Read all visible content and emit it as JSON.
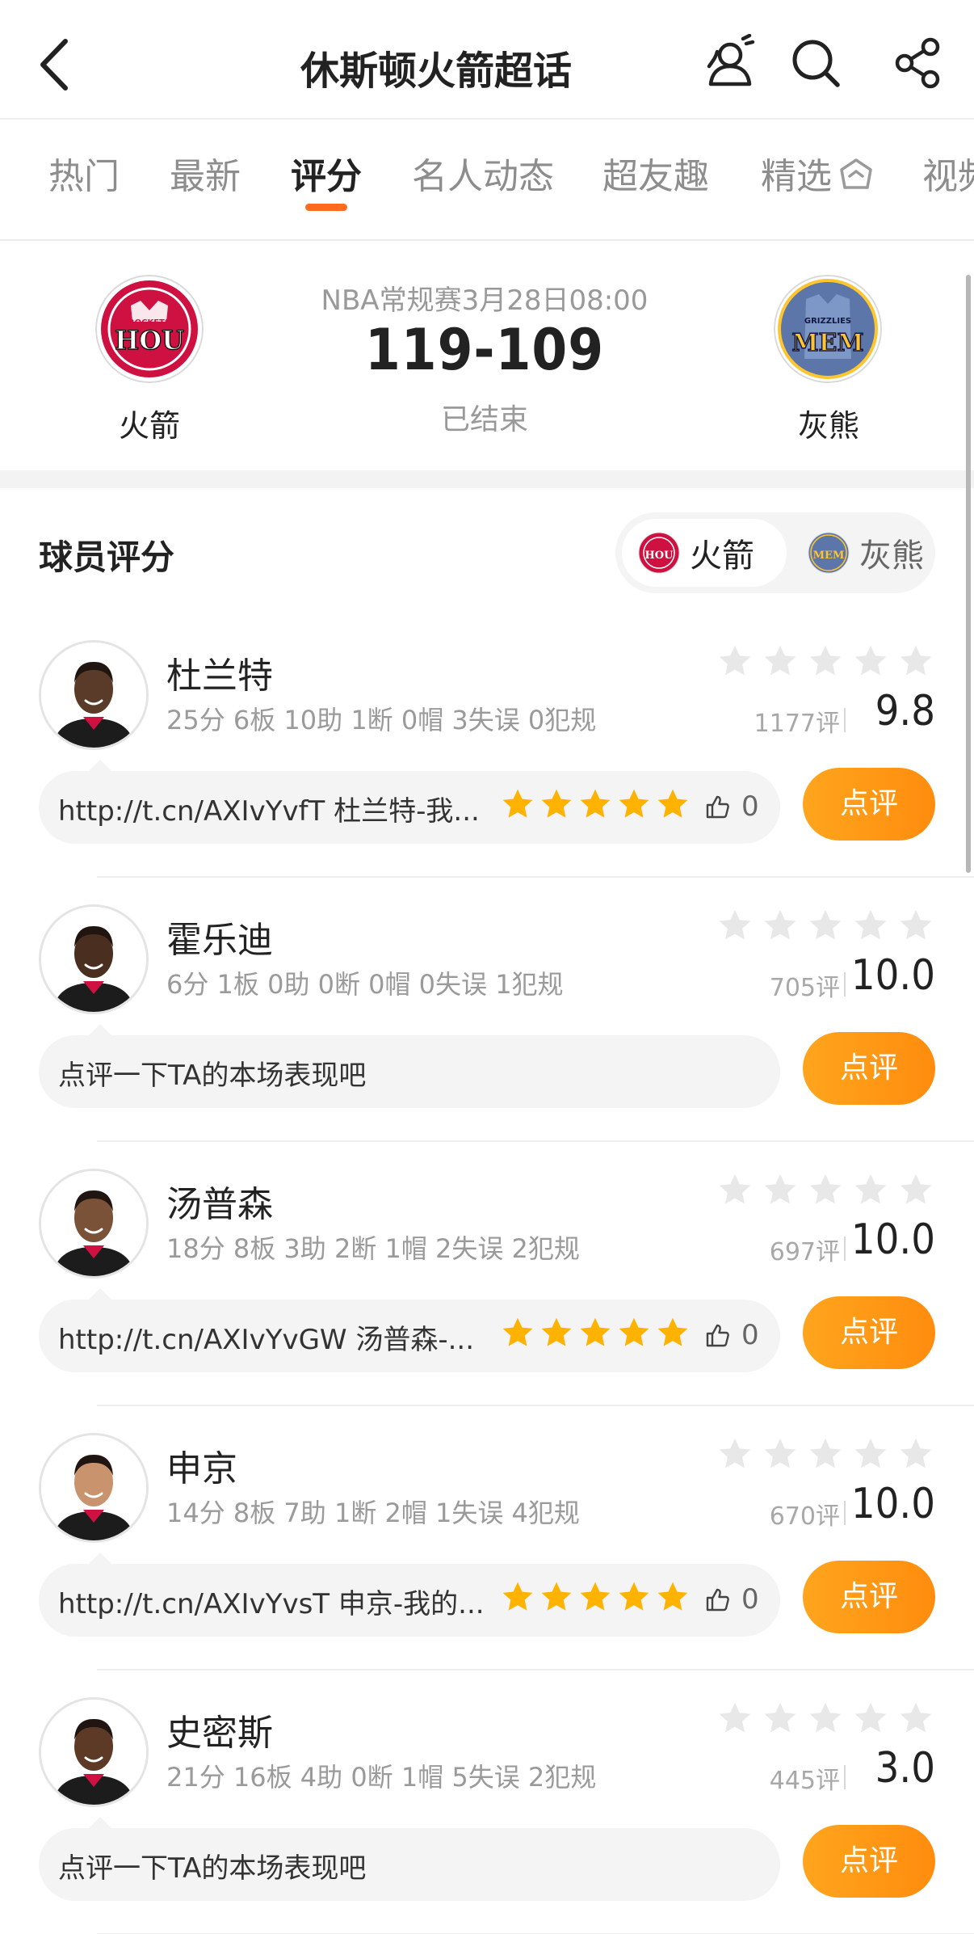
{
  "header": {
    "title": "休斯顿火箭超话",
    "icons": [
      "back-icon",
      "people-icon",
      "search-icon",
      "share-icon"
    ]
  },
  "tabs": [
    {
      "label": "热门",
      "active": false
    },
    {
      "label": "最新",
      "active": false
    },
    {
      "label": "评分",
      "active": true
    },
    {
      "label": "名人动态",
      "active": false
    },
    {
      "label": "超友趣",
      "active": false
    },
    {
      "label": "精选",
      "active": false
    },
    {
      "label": "视频",
      "active": false
    }
  ],
  "match": {
    "home_team": "火箭",
    "home_abbr": "HOU",
    "home_logo_text": "ROCKETS",
    "away_team": "灰熊",
    "away_abbr": "MEM",
    "away_logo_text": "GRIZZLIES",
    "info": "NBA常规赛3月28日08:00",
    "score": "119-109",
    "status": "已结束"
  },
  "section": {
    "title": "球员评分",
    "toggle": [
      {
        "label": "火箭",
        "active": true
      },
      {
        "label": "灰熊",
        "active": false
      }
    ]
  },
  "players": [
    {
      "name": "杜兰特",
      "stats": "25分 6板 10助 1断 0帽 3失误 0犯规",
      "count": "1177评",
      "score": "9.8",
      "comment": "http://t.cn/AXIvYvfT 杜兰特-我...",
      "has_rating": true,
      "likes": "0",
      "button": "点评"
    },
    {
      "name": "霍乐迪",
      "stats": "6分 1板 0助 0断 0帽 0失误 1犯规",
      "count": "705评",
      "score": "10.0",
      "comment": "点评一下TA的本场表现吧",
      "has_rating": false,
      "likes": "",
      "button": "点评"
    },
    {
      "name": "汤普森",
      "stats": "18分 8板 3助 2断 1帽 2失误 2犯规",
      "count": "697评",
      "score": "10.0",
      "comment": "http://t.cn/AXIvYvGW 汤普森-...",
      "has_rating": true,
      "likes": "0",
      "button": "点评"
    },
    {
      "name": "申京",
      "stats": "14分 8板 7助 1断 2帽 1失误 4犯规",
      "count": "670评",
      "score": "10.0",
      "comment": "http://t.cn/AXIvYvsT 申京-我的...",
      "has_rating": true,
      "likes": "0",
      "button": "点评"
    },
    {
      "name": "史密斯",
      "stats": "21分 16板 4助 0断 1帽 5失误 2犯规",
      "count": "445评",
      "score": "3.0",
      "comment": "点评一下TA的本场表现吧",
      "has_rating": false,
      "likes": "",
      "button": "点评"
    }
  ],
  "colors": {
    "accent": "#ff6a1c",
    "button": "#ff9a16",
    "star_full": "#ffb300",
    "star_empty": "#e8e8e8",
    "rockets_red": "#ce1141",
    "grizzlies_blue": "#5d76a9",
    "grizzlies_yellow": "#ffc52f"
  }
}
